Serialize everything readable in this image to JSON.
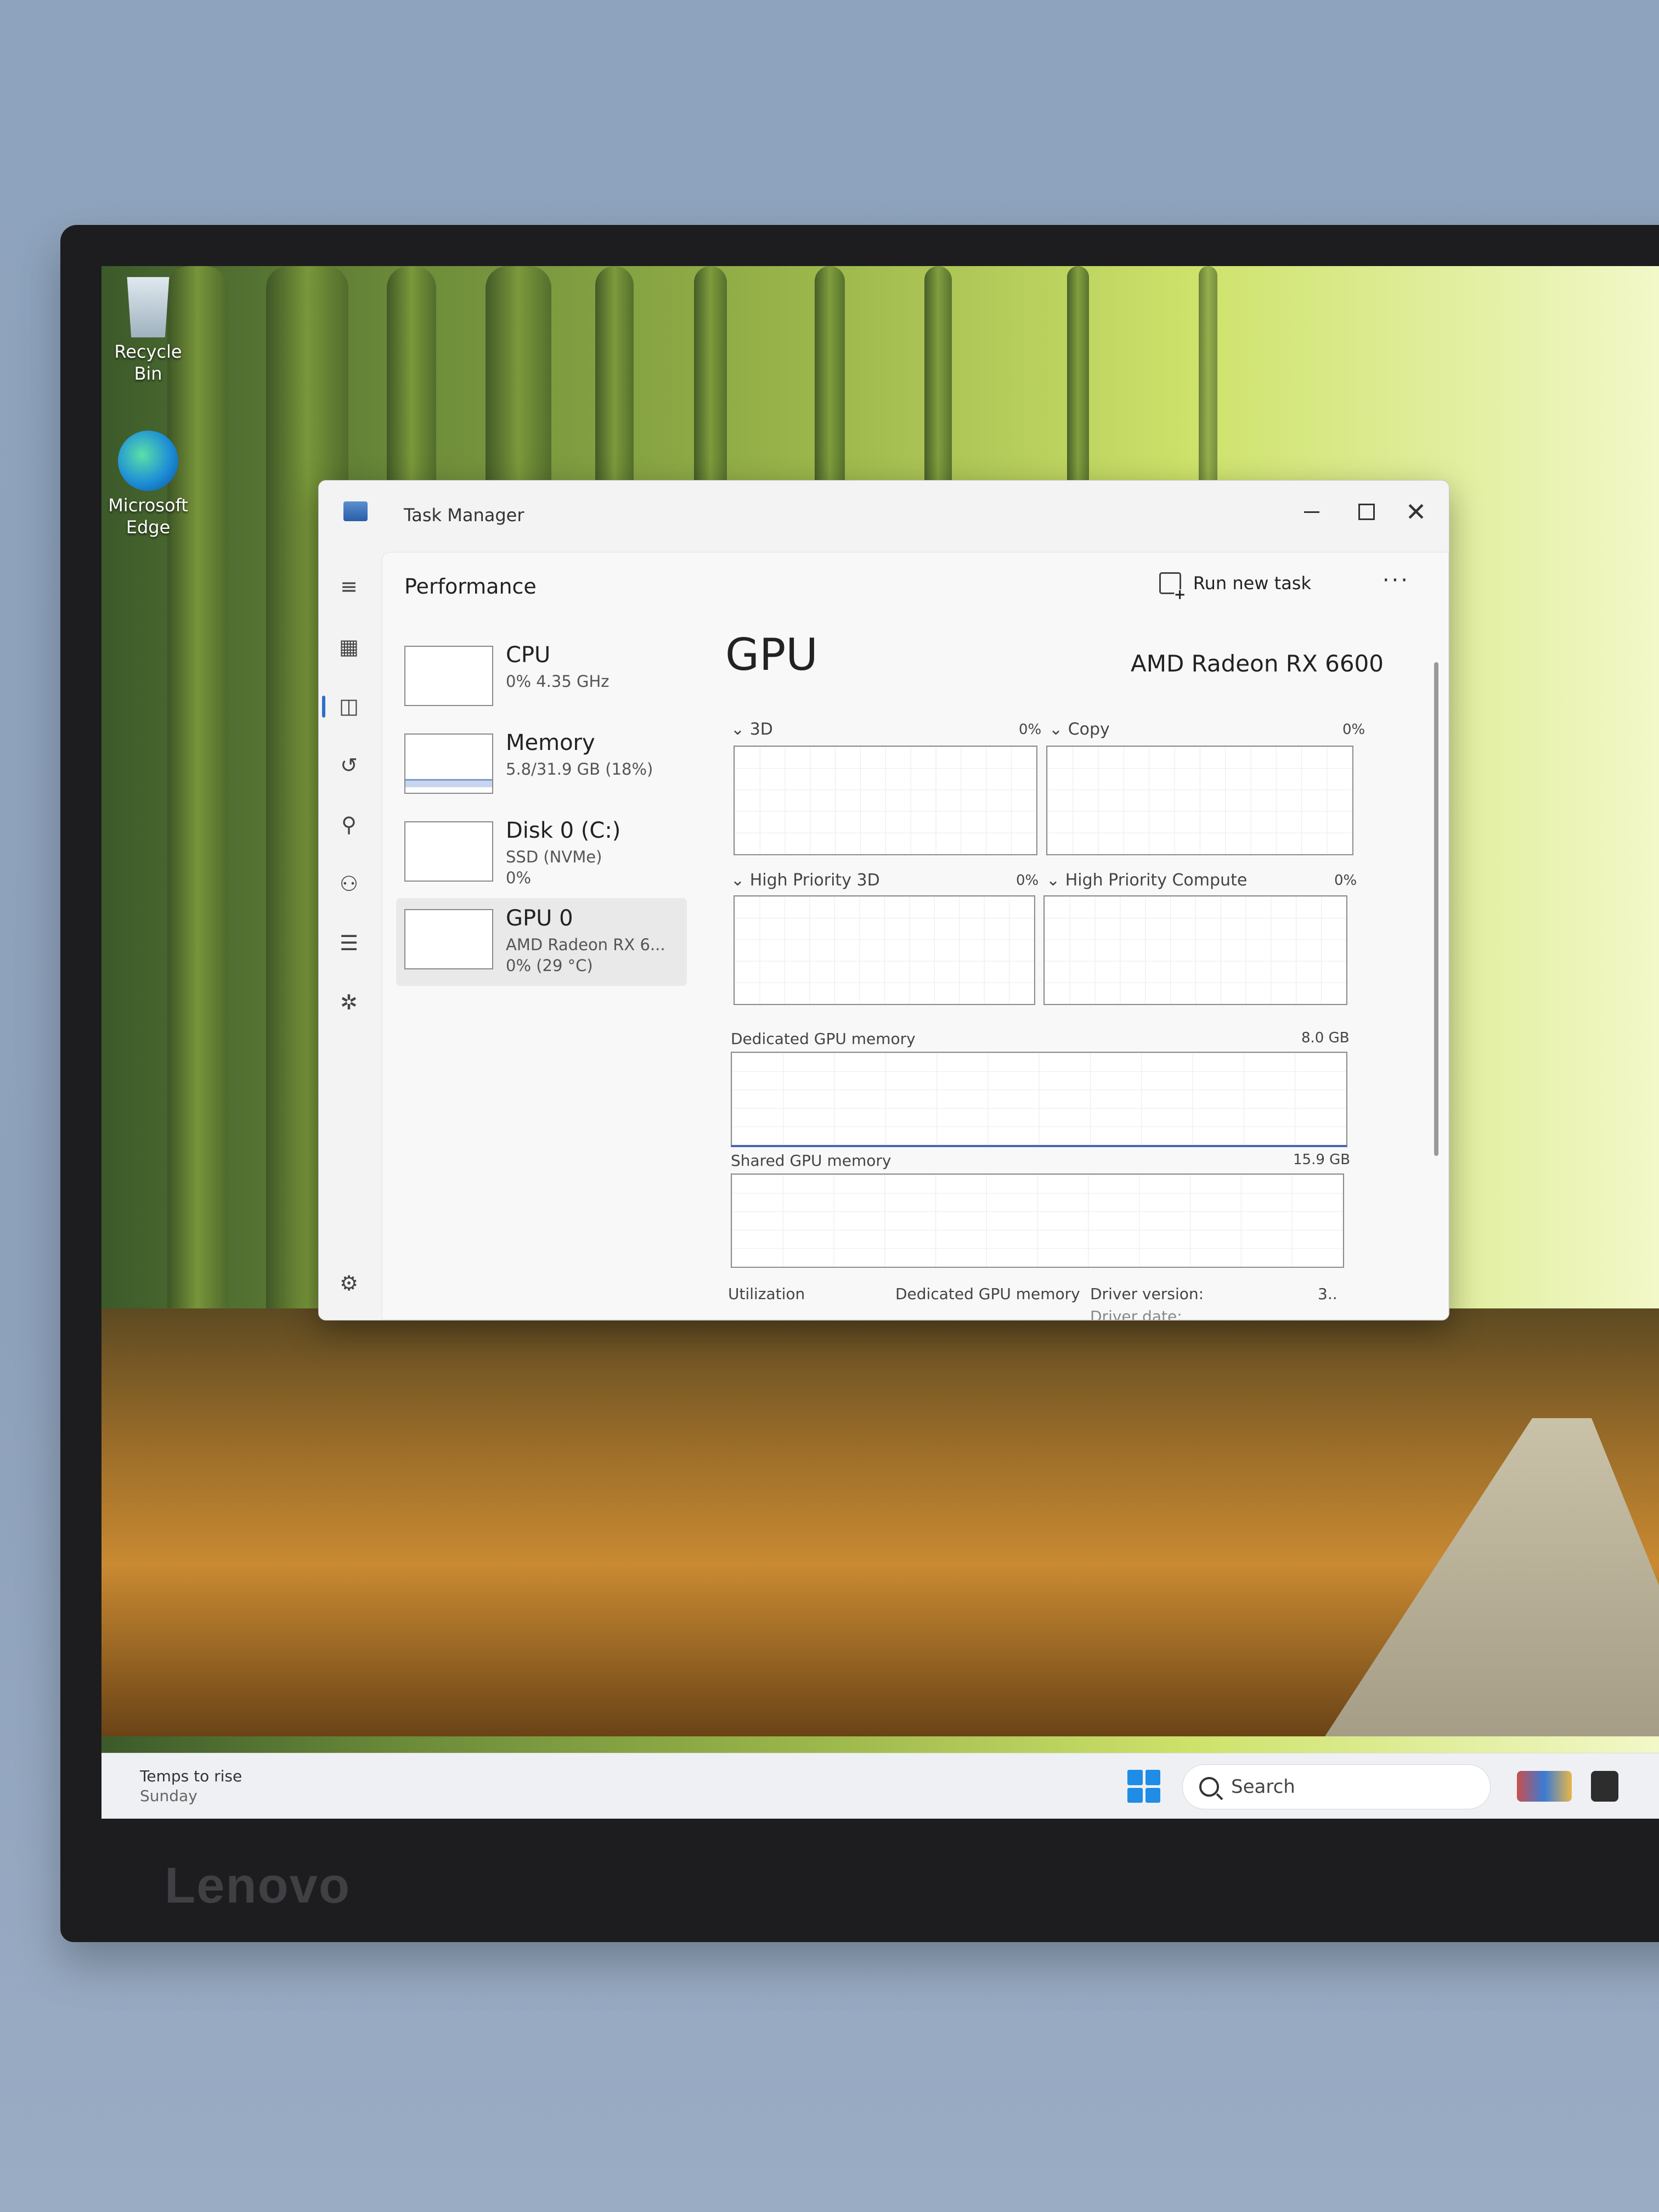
{
  "desktop": {
    "icons": [
      {
        "label": "Recycle Bin"
      },
      {
        "label_line1": "Microsoft",
        "label_line2": "Edge"
      }
    ]
  },
  "monitor": {
    "brand": "Lenovo"
  },
  "taskbar": {
    "weather_title": "Temps to rise",
    "weather_sub": "Sunday",
    "search_label": "Search"
  },
  "window": {
    "title": "Task Manager",
    "header": {
      "page_title": "Performance",
      "run_new_task": "Run new task",
      "more": "···"
    },
    "processes": [
      {
        "name": "CPU",
        "line1": "0% 4.35 GHz"
      },
      {
        "name": "Memory",
        "line1": "5.8/31.9 GB (18%)"
      },
      {
        "name": "Disk 0 (C:)",
        "line1": "SSD (NVMe)",
        "line2": "0%"
      },
      {
        "name": "GPU 0",
        "line1": "AMD Radeon RX 6...",
        "line2": "0% (29 °C)"
      }
    ],
    "detail": {
      "title": "GPU",
      "model": "AMD Radeon RX 6600",
      "engines": [
        {
          "label": "3D",
          "value": "0%"
        },
        {
          "label": "Copy",
          "value": "0%"
        },
        {
          "label": "High Priority 3D",
          "value": "0%"
        },
        {
          "label": "High Priority Compute",
          "value": "0%"
        }
      ],
      "dedicated_label": "Dedicated GPU memory",
      "dedicated_value": "8.0 GB",
      "shared_label": "Shared GPU memory",
      "shared_value": "15.9 GB",
      "stats": {
        "utilization": "Utilization",
        "dedicated": "Dedicated GPU memory",
        "driver_version": "Driver version:",
        "driver_version_value": "3..",
        "driver_date": "Driver date:"
      }
    }
  }
}
